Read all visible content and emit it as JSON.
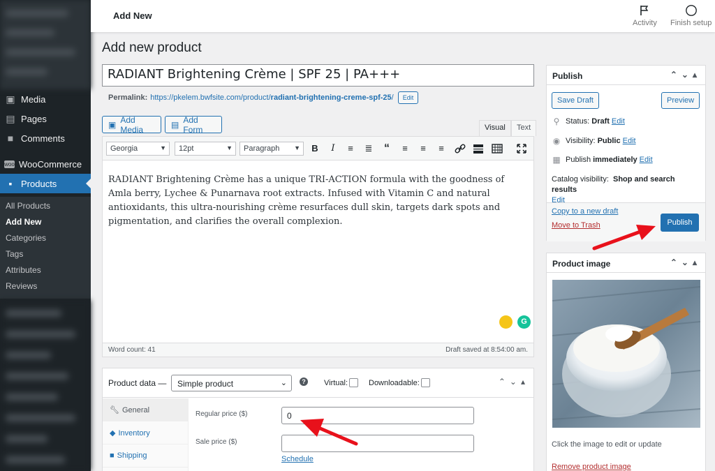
{
  "sidebar": {
    "items": [
      {
        "label": "Media",
        "icon": "media-icon"
      },
      {
        "label": "Pages",
        "icon": "pages-icon"
      },
      {
        "label": "Comments",
        "icon": "comments-icon"
      },
      {
        "label": "WooCommerce",
        "icon": "woo-icon"
      },
      {
        "label": "Products",
        "icon": "products-icon"
      }
    ],
    "submenu": [
      "All Products",
      "Add New",
      "Categories",
      "Tags",
      "Attributes",
      "Reviews"
    ]
  },
  "topbar": {
    "title": "Add New",
    "activity_label": "Activity",
    "finish_setup_label": "Finish setup"
  },
  "page": {
    "heading": "Add new product",
    "product_title": "RADIANT Brightening Crème | SPF 25 | PA+++",
    "permalink_label": "Permalink:",
    "permalink_prefix": "https://pkelem.bwfsite.com/product/",
    "permalink_slug": "radiant-brightening-creme-spf-25",
    "permalink_suffix": "/",
    "permalink_edit": "Edit"
  },
  "editor": {
    "add_media": "Add Media",
    "add_form": "Add Form",
    "tab_visual": "Visual",
    "tab_text": "Text",
    "font_family": "Georgia",
    "font_size": "12pt",
    "paragraph": "Paragraph",
    "body": "RADIANT Brightening Crème has a unique TRI-ACTION formula with the goodness of Amla berry, Lychee & Punarnava root extracts. Infused with Vitamin C and natural antioxidants, this ultra-nourishing crème resurfaces dull skin, targets dark spots and pigmentation, and clarifies the overall complexion.",
    "word_count": "Word count: 41",
    "draft_saved": "Draft saved at 8:54:00 am."
  },
  "product_data": {
    "label": "Product data —",
    "type": "Simple product",
    "virtual_label": "Virtual:",
    "downloadable_label": "Downloadable:",
    "tabs": [
      "General",
      "Inventory",
      "Shipping"
    ],
    "regular_price_label": "Regular price ($)",
    "regular_price_value": "0",
    "sale_price_label": "Sale price ($)",
    "sale_price_value": "",
    "schedule": "Schedule"
  },
  "publish_box": {
    "title": "Publish",
    "save_draft": "Save Draft",
    "preview": "Preview",
    "status_label": "Status:",
    "status_value": "Draft",
    "visibility_label": "Visibility:",
    "visibility_value": "Public",
    "publish_label": "Publish",
    "publish_value": "immediately",
    "catalog_label": "Catalog visibility:",
    "catalog_value": "Shop and search results",
    "edit": "Edit",
    "copy_draft": "Copy to a new draft",
    "move_trash": "Move to Trash",
    "publish_button": "Publish"
  },
  "product_image_box": {
    "title": "Product image",
    "hint": "Click the image to edit or update",
    "remove": "Remove product image"
  },
  "colors": {
    "accent": "#2271b1",
    "sidebar": "#1d2327",
    "annotation_arrow": "#e8111b"
  }
}
